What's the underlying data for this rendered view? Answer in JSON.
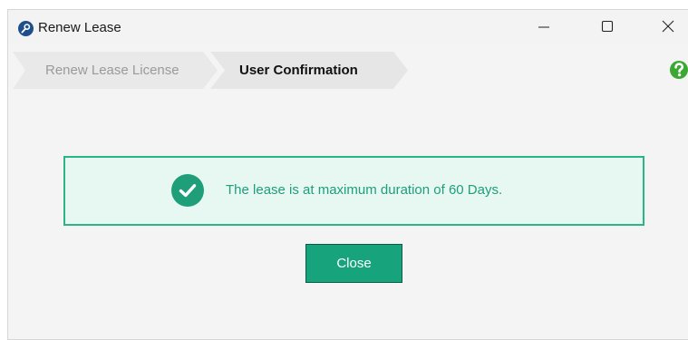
{
  "window": {
    "title": "Renew Lease"
  },
  "wizard": {
    "steps": [
      {
        "label": "Renew Lease License",
        "state": "inactive"
      },
      {
        "label": "User Confirmation",
        "state": "active"
      }
    ]
  },
  "message": {
    "text": "The lease is at maximum duration of 60 Days.",
    "icon": "check-circle-icon",
    "status": "success"
  },
  "actions": {
    "close_label": "Close"
  },
  "colors": {
    "accent": "#17a37c",
    "message_background": "#e7f8f3",
    "message_border": "#2bb38a",
    "message_text": "#1e9e79",
    "help_icon": "#3aa832",
    "app_icon": "#1f4e8c"
  }
}
